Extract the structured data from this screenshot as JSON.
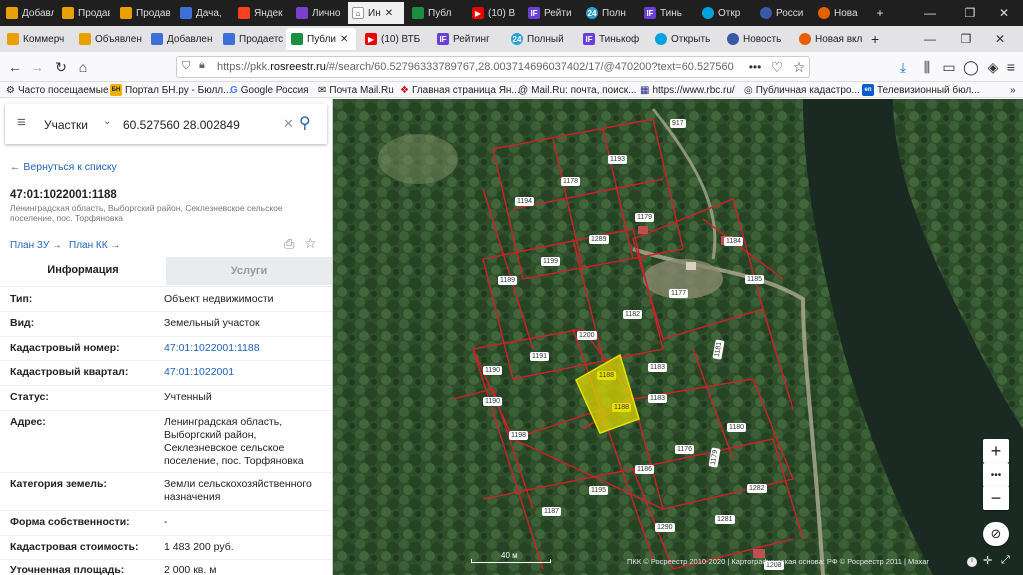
{
  "outer_tabs": [
    "Добавле",
    "Продав",
    "Продав",
    "Дача,",
    "Яндек",
    "Лично",
    "Ин",
    "Публ",
    "(10) В",
    "Рейти",
    "Полн",
    "Тинь",
    "Откр",
    "Росси",
    "Нова"
  ],
  "firefox_tabs": [
    "Коммерч",
    "Объявлен",
    "Добавлен",
    "Продаетс",
    "Публи",
    "(10) ВТБ",
    "Рейтинг",
    "Полный",
    "Тинькоф",
    "Открыть",
    "Новость",
    "Новая вкл"
  ],
  "nav": {
    "url_prefix": "https://pkk.",
    "url_domain": "rosreestr.ru",
    "url_path": "/#/search/60.52796333789767,28.003714696037402/17/@470200?text=60.527560",
    "tab_close": "✕",
    "new_tab": "+"
  },
  "bookmarks": [
    "Часто посещаемые",
    "Портал БН.ру - Бюлл...",
    "Google Россия",
    "Почта Mail.Ru",
    "Главная страница Ян...",
    "Mail.Ru: почта, поиск...",
    "https://www.rbc.ru/",
    "Публичная кадастро...",
    "Телевизионный бюл..."
  ],
  "search": {
    "type": "Участки",
    "query": "60.527560 28.002849"
  },
  "back_link": "← Вернуться к списку",
  "object": {
    "number": "47:01:1022001:1188",
    "address_short": "Ленинградская область, Выборгский район, Секлезневское сельское поселение, пос. Торфяновка",
    "plan_zu": "План ЗУ →",
    "plan_kk": "План КК →"
  },
  "info_tabs": {
    "info": "Информация",
    "services": "Услуги"
  },
  "properties": [
    {
      "label": "Тип:",
      "value": "Объект недвижимости",
      "link": false
    },
    {
      "label": "Вид:",
      "value": "Земельный участок",
      "link": false
    },
    {
      "label": "Кадастровый номер:",
      "value": "47:01:1022001:1188",
      "link": true
    },
    {
      "label": "Кадастровый квартал:",
      "value": "47:01:1022001",
      "link": true
    },
    {
      "label": "Статус:",
      "value": "Учтенный",
      "link": false
    },
    {
      "label": "Адрес:",
      "value": "Ленинградская область, Выборгский район, Секлезневское сельское поселение, пос. Торфяновка",
      "link": false
    },
    {
      "label": "Категория земель:",
      "value": "Земли сельскохозяйственного назначения",
      "link": false
    },
    {
      "label": "Форма собственности:",
      "value": "-",
      "link": false
    },
    {
      "label": "Кадастровая стоимость:",
      "value": "1 483 200 руб.",
      "link": false
    },
    {
      "label": "Уточненная площадь:",
      "value": "2 000 кв. м",
      "link": false
    }
  ],
  "map": {
    "parcel_labels": [
      "917",
      "1193",
      "1178",
      "1194",
      "1179",
      "1289",
      "1184",
      "1199",
      "1185",
      "1189",
      "1177",
      "1182",
      "1200",
      "1181",
      "1191",
      "1183",
      "1190",
      "1188",
      "1188",
      "1183",
      "1190",
      "1198",
      "1180",
      "1176",
      "1186",
      "1179",
      "1195",
      "1282",
      "1187",
      "1281",
      "1290",
      "1208"
    ],
    "scale": "40 м",
    "copyright": "ПКК © Росреестр 2010-2020 | Картографическая основа: РФ © Росреестр 2011 | Maxar",
    "zoom_in": "+",
    "zoom_out": "−",
    "more": "•••"
  },
  "colors": {
    "parcel_border": "#d0202a",
    "selected_fill": "#e8e000",
    "link": "#1e62b8"
  }
}
